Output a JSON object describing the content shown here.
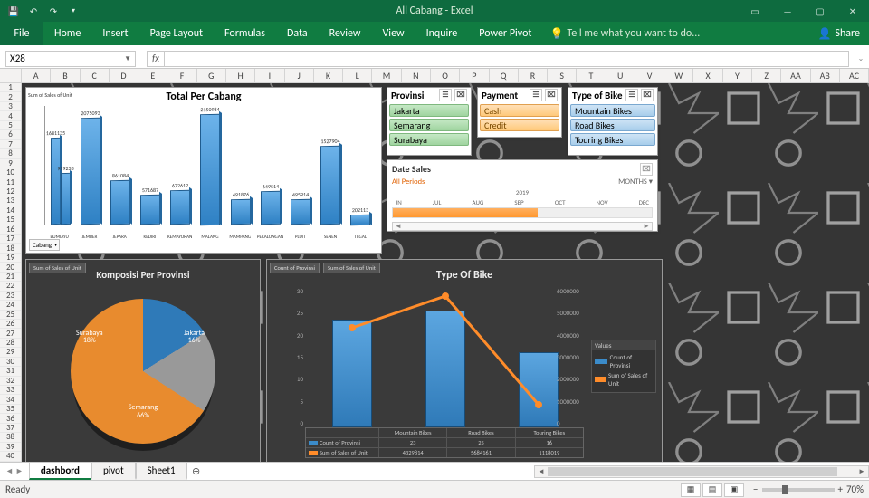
{
  "titlebar": {
    "title": "All Cabang - Excel"
  },
  "ribbon": {
    "file": "File",
    "tabs": [
      "Home",
      "Insert",
      "Page Layout",
      "Formulas",
      "Data",
      "Review",
      "View",
      "Inquire",
      "Power Pivot"
    ],
    "tell": "Tell me what you want to do...",
    "share": "Share"
  },
  "namebox": "X28",
  "columns": [
    "A",
    "B",
    "C",
    "D",
    "E",
    "F",
    "G",
    "H",
    "I",
    "J",
    "K",
    "L",
    "M",
    "N",
    "O",
    "P",
    "Q",
    "R",
    "S",
    "T",
    "U",
    "V",
    "W",
    "X",
    "Y",
    "Z",
    "AA",
    "AB",
    "AC"
  ],
  "rows_visible": 40,
  "slicers": {
    "provinsi": {
      "title": "Provinsi",
      "items": [
        "Jakarta",
        "Semarang",
        "Surabaya"
      ]
    },
    "payment": {
      "title": "Payment",
      "items": [
        "Cash",
        "Credit"
      ]
    },
    "bike": {
      "title": "Type of Bike",
      "items": [
        "Mountain Bikes",
        "Road Bikes",
        "Touring Bikes"
      ]
    }
  },
  "timeline": {
    "title": "Date Sales",
    "all": "All Periods",
    "period_label": "MONTHS",
    "year": "2019",
    "months": [
      "JN",
      "JUL",
      "AUG",
      "SEP",
      "OCT",
      "NOV",
      "DEC"
    ]
  },
  "chart1": {
    "ylabel": "Sum of Sales of Unit",
    "title": "Total Per Cabang",
    "filter": "Cabang",
    "chart_data": {
      "type": "bar",
      "categories": [
        "BUMIAYU",
        "JEMBER",
        "JEPARA",
        "KEDIRI",
        "KEMAYORAN",
        "MALANG",
        "MAMPANG",
        "PEKALONGAN",
        "PLUIT",
        "SENEN",
        "TEGAL"
      ],
      "groups": [
        {
          "values": [
            1681135,
            999233
          ]
        },
        {
          "values": [
            2075093
          ]
        },
        {
          "values": [
            861084
          ]
        },
        {
          "values": [
            571687
          ]
        },
        {
          "values": [
            672612
          ]
        },
        {
          "values": [
            2150984
          ]
        },
        {
          "values": [
            491876
          ]
        },
        {
          "values": [
            649514
          ]
        },
        {
          "values": [
            495914
          ]
        },
        {
          "values": [
            1527904
          ]
        },
        {
          "values": [
            202113
          ]
        }
      ],
      "ylim": [
        0,
        2300000
      ]
    }
  },
  "chart2": {
    "pill1": "Sum of Sales of Unit",
    "title": "Komposisi Per Provinsi",
    "chart_data": {
      "type": "pie",
      "slices": [
        {
          "label": "Jakarta",
          "pct": 16
        },
        {
          "label": "Surabaya",
          "pct": 18
        },
        {
          "label": "Semarang",
          "pct": 66
        }
      ]
    }
  },
  "chart3": {
    "pill1": "Count of Provinsi",
    "pill2": "Sum of Sales of Unit",
    "title": "Type Of Bike",
    "legend_title": "Values",
    "legend": [
      "Count of Provinsi",
      "Sum of Sales of Unit"
    ],
    "chart_data": {
      "type": "bar",
      "categories": [
        "Mountain Bikes",
        "Road Bikes",
        "Touring Bikes"
      ],
      "series": [
        {
          "name": "Count of Provinsi",
          "values": [
            23,
            25,
            16
          ]
        },
        {
          "name": "Sum of Sales of Unit",
          "values": [
            4329814,
            5684161,
            1118019
          ]
        }
      ],
      "ylim": [
        0,
        30
      ],
      "ylim2": [
        0,
        6000000
      ],
      "yticks": [
        0,
        5,
        10,
        15,
        20,
        25,
        30
      ],
      "yticks2": [
        0,
        1000000,
        2000000,
        3000000,
        4000000,
        5000000,
        6000000
      ]
    }
  },
  "sheettabs": [
    "dashbord",
    "pivot",
    "Sheet1"
  ],
  "active_sheet": 0,
  "status": {
    "ready": "Ready",
    "zoom": "70%"
  }
}
